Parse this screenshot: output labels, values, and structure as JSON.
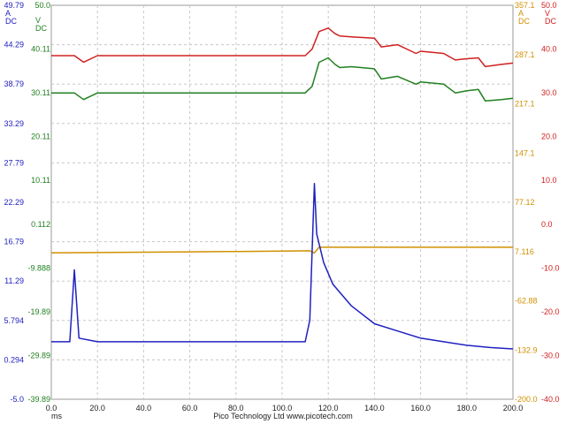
{
  "chart_data": {
    "type": "line",
    "x_unit": "ms",
    "xlim": [
      0,
      200
    ],
    "x_ticks": [
      "0.0",
      "20.0",
      "40.0",
      "60.0",
      "80.0",
      "100.0",
      "120.0",
      "140.0",
      "160.0",
      "180.0",
      "200.0"
    ],
    "footer": "Pico Technology Ltd     www.picotech.com",
    "axes": [
      {
        "id": "A",
        "side": "left",
        "color": "#2020c0",
        "unit": "A",
        "coupling": "DC",
        "min": -5.0,
        "max": 49.79,
        "ticks": [
          "49.79",
          "44.29",
          "38.79",
          "33.29",
          "27.79",
          "22.29",
          "16.79",
          "11.29",
          "5.794",
          "0.294",
          "-5.0"
        ]
      },
      {
        "id": "B",
        "side": "left",
        "color": "#208020",
        "unit": "V",
        "coupling": "DC",
        "min": -39.89,
        "max": 50.0,
        "ticks": [
          "50.0",
          "40.11",
          "30.11",
          "20.11",
          "10.11",
          "0.112",
          "-9.888",
          "-19.89",
          "-29.89",
          "-39.89"
        ]
      },
      {
        "id": "C",
        "side": "right",
        "color": "#d09000",
        "unit": "A",
        "coupling": "DC",
        "min": -200.0,
        "max": 357.1,
        "ticks": [
          "357.1",
          "287.1",
          "217.1",
          "147.1",
          "77.12",
          "7.116",
          "-62.88",
          "-132.9",
          "-200.0"
        ]
      },
      {
        "id": "D",
        "side": "right",
        "color": "#d02020",
        "unit": "V",
        "coupling": "DC",
        "min": -40.0,
        "max": 50.0,
        "ticks": [
          "50.0",
          "40.0",
          "30.0",
          "20.0",
          "10.0",
          "0.0",
          "-10.0",
          "-20.0",
          "-30.0",
          "-40.0"
        ]
      }
    ],
    "series": [
      {
        "axis": "D",
        "color": "#d02020",
        "x": [
          0,
          10,
          14,
          20,
          40,
          60,
          80,
          100,
          110,
          113,
          116,
          120,
          123,
          125,
          130,
          140,
          143,
          150,
          158,
          160,
          170,
          175,
          180,
          185,
          188,
          195,
          200
        ],
        "y": [
          38.5,
          38.5,
          37.0,
          38.5,
          38.5,
          38.5,
          38.5,
          38.5,
          38.5,
          40.0,
          44.0,
          44.8,
          43.5,
          43.0,
          42.8,
          42.5,
          40.5,
          41.0,
          39.0,
          39.5,
          39.0,
          37.5,
          37.8,
          38.0,
          36.0,
          36.5,
          36.8
        ]
      },
      {
        "axis": "B",
        "color": "#208020",
        "x": [
          0,
          10,
          14,
          20,
          40,
          60,
          80,
          100,
          110,
          113,
          116,
          120,
          123,
          125,
          130,
          140,
          143,
          150,
          158,
          160,
          170,
          175,
          180,
          185,
          188,
          195,
          200
        ],
        "y": [
          30.0,
          30.0,
          28.5,
          30.0,
          30.0,
          30.0,
          30.0,
          30.0,
          30.0,
          31.5,
          37.0,
          38.0,
          36.5,
          35.8,
          36.0,
          35.5,
          33.2,
          33.8,
          32.0,
          32.5,
          32.0,
          30.0,
          30.5,
          30.8,
          28.2,
          28.5,
          28.8
        ]
      },
      {
        "axis": "C",
        "color": "#d09000",
        "x": [
          0,
          20,
          40,
          60,
          80,
          100,
          112,
          114,
          116,
          140,
          160,
          180,
          200
        ],
        "y": [
          7.0,
          7.5,
          8.0,
          8.5,
          9.0,
          9.5,
          10.0,
          7.0,
          15.0,
          15.0,
          15.0,
          15.0,
          15.0
        ]
      },
      {
        "axis": "A",
        "color": "#2020c0",
        "x": [
          0,
          8,
          10,
          12,
          20,
          30,
          40,
          50,
          60,
          70,
          80,
          90,
          100,
          110,
          112,
          114,
          115,
          118,
          122,
          130,
          140,
          150,
          160,
          170,
          180,
          190,
          200
        ],
        "y": [
          3.0,
          3.0,
          13.0,
          3.5,
          3.0,
          3.0,
          3.0,
          3.0,
          3.0,
          3.0,
          3.0,
          3.0,
          3.0,
          3.0,
          6.0,
          25.0,
          18.0,
          14.0,
          11.0,
          8.0,
          5.5,
          4.5,
          3.5,
          3.0,
          2.5,
          2.2,
          2.0
        ]
      }
    ]
  }
}
